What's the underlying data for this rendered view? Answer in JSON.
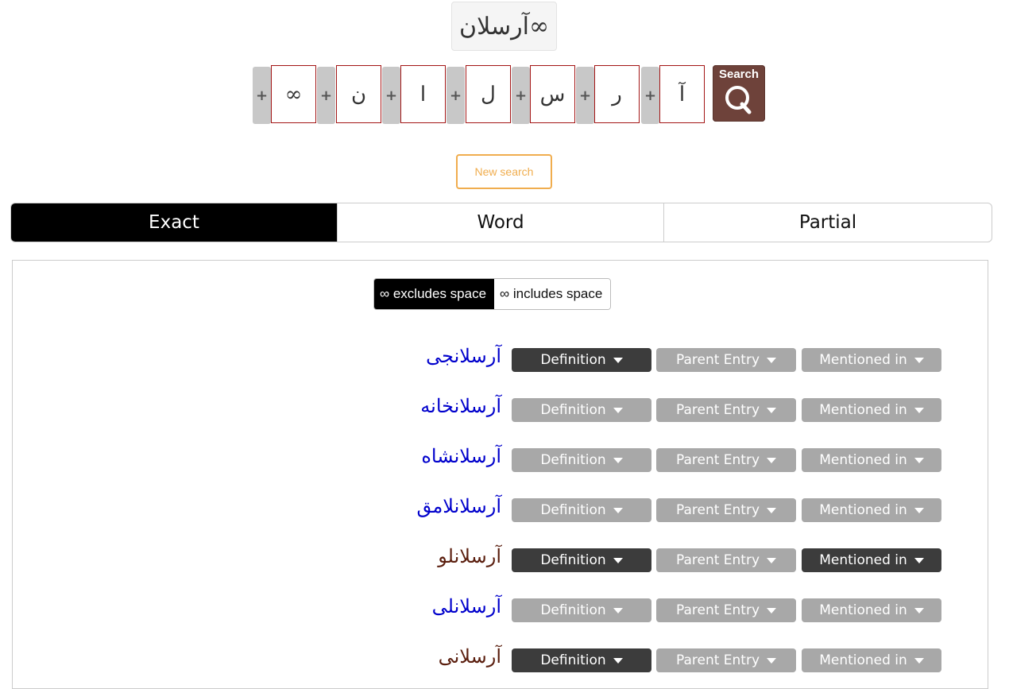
{
  "query": "آرسلان∞",
  "letters": [
    "∞",
    "ن",
    "ا",
    "ل",
    "س",
    "ر",
    "آ"
  ],
  "plus_label": "+",
  "search_label": "Search",
  "new_search_label": "New search",
  "tabs": [
    {
      "label": "Exact",
      "active": true
    },
    {
      "label": "Word",
      "active": false
    },
    {
      "label": "Partial",
      "active": false
    }
  ],
  "space_toggle": {
    "excludes": "∞ excludes space",
    "includes": "∞ includes space"
  },
  "button_labels": {
    "definition": "Definition",
    "parent": "Parent Entry",
    "mentioned": "Mentioned in"
  },
  "colors": {
    "link_blue": "#0000cc",
    "link_brown": "#5a1e0e",
    "button_dark": "#3c3c3c",
    "button_light": "#a8a8a8",
    "accent_orange": "#f0ad4e",
    "search_brown": "#6e423a"
  },
  "results": [
    {
      "word": "آرسلانجی",
      "color": "blue",
      "definition": true,
      "parent": false,
      "mentioned": false
    },
    {
      "word": "آرسلانخانه",
      "color": "blue",
      "definition": false,
      "parent": false,
      "mentioned": false
    },
    {
      "word": "آرسلانشاه",
      "color": "blue",
      "definition": false,
      "parent": false,
      "mentioned": false
    },
    {
      "word": "آرسلانلامق",
      "color": "blue",
      "definition": false,
      "parent": false,
      "mentioned": false
    },
    {
      "word": "آرسلانلو",
      "color": "brown",
      "definition": true,
      "parent": false,
      "mentioned": true
    },
    {
      "word": "آرسلانلی",
      "color": "blue",
      "definition": false,
      "parent": false,
      "mentioned": false
    },
    {
      "word": "آرسلانی",
      "color": "brown",
      "definition": true,
      "parent": false,
      "mentioned": false
    }
  ]
}
